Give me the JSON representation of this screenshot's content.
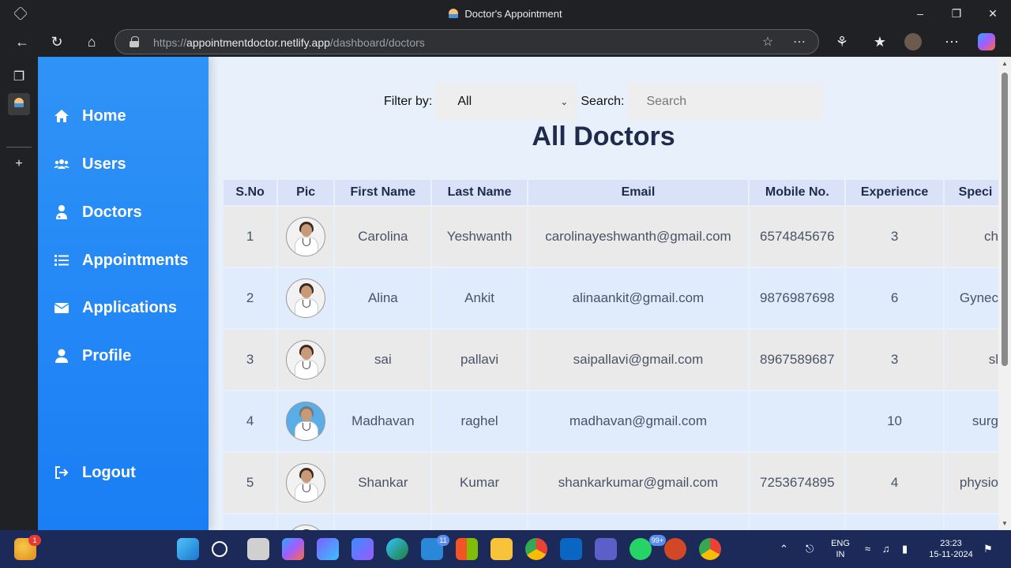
{
  "browser": {
    "tab_title": "Doctor's Appointment",
    "url_prefix": "https://",
    "url_host": "appointmentdoctor.netlify.app",
    "url_path": "/dashboard/doctors"
  },
  "sidebar": {
    "items": [
      {
        "label": "Home",
        "icon": "home-icon"
      },
      {
        "label": "Users",
        "icon": "users-icon"
      },
      {
        "label": "Doctors",
        "icon": "doctor-icon"
      },
      {
        "label": "Appointments",
        "icon": "list-icon"
      },
      {
        "label": "Applications",
        "icon": "envelope-icon"
      },
      {
        "label": "Profile",
        "icon": "user-icon"
      }
    ],
    "logout": "Logout"
  },
  "filter": {
    "label": "Filter by:",
    "selected": "All",
    "search_label": "Search:",
    "search_placeholder": "Search"
  },
  "title": "All Doctors",
  "table": {
    "headers": [
      "S.No",
      "Pic",
      "First Name",
      "Last Name",
      "Email",
      "Mobile No.",
      "Experience",
      "Speci"
    ],
    "rows": [
      {
        "sno": "1",
        "first": "Carolina",
        "last": "Yeshwanth",
        "email": "carolinayeshwanth@gmail.com",
        "mobile": "6574845676",
        "exp": "3",
        "spec": "ch"
      },
      {
        "sno": "2",
        "first": "Alina",
        "last": "Ankit",
        "email": "alinaankit@gmail.com",
        "mobile": "9876987698",
        "exp": "6",
        "spec": "Gynec"
      },
      {
        "sno": "3",
        "first": "sai",
        "last": "pallavi",
        "email": "saipallavi@gmail.com",
        "mobile": "8967589687",
        "exp": "3",
        "spec": "sl"
      },
      {
        "sno": "4",
        "first": "Madhavan",
        "last": "raghel",
        "email": "madhavan@gmail.com",
        "mobile": "",
        "exp": "10",
        "spec": "surg"
      },
      {
        "sno": "5",
        "first": "Shankar",
        "last": "Kumar",
        "email": "shankarkumar@gmail.com",
        "mobile": "7253674895",
        "exp": "4",
        "spec": "physio"
      }
    ]
  },
  "taskbar": {
    "weather_badge": "1",
    "mail_badge": "11",
    "whatsapp_badge": "99+",
    "lang": "ENG",
    "region": "IN",
    "time": "23:23",
    "date": "15-11-2024"
  },
  "colors": {
    "sidebar": "#1a7ef5",
    "page_bg": "#e8f0fb",
    "title": "#1e2b4d"
  }
}
